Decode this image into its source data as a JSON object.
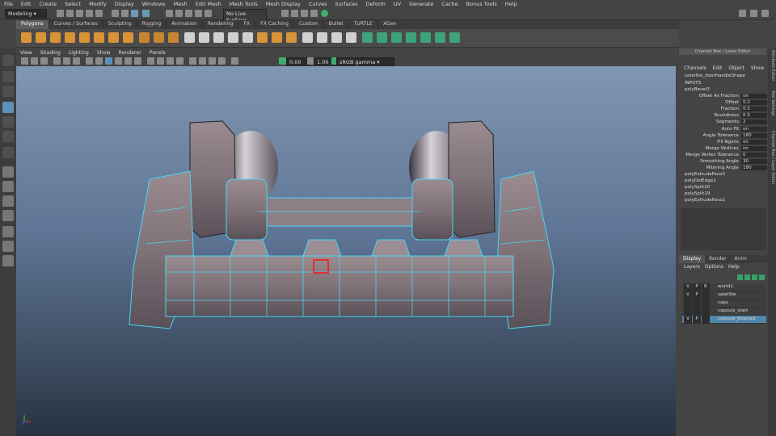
{
  "menubar": [
    "File",
    "Edit",
    "Create",
    "Select",
    "Modify",
    "Display",
    "Windows",
    "Mesh",
    "Edit Mesh",
    "Mesh Tools",
    "Mesh Display",
    "Curves",
    "Surfaces",
    "Deform",
    "UV",
    "Generate",
    "Cache",
    "Bonus Tools",
    "Help"
  ],
  "status": {
    "mode": "Modeling",
    "live_surface": "No Live Surface"
  },
  "shelf_tabs": [
    "Polygons",
    "Curves / Surfaces",
    "Sculpting",
    "Rigging",
    "Animation",
    "Rendering",
    "FX",
    "FX Caching",
    "Custom",
    "Bullet",
    "TURTLE",
    "XGen"
  ],
  "shelf_active": "Polygons",
  "panel_menu": [
    "View",
    "Shading",
    "Lighting",
    "Show",
    "Renderer",
    "Panels"
  ],
  "panel_tools": {
    "field1": "0.00",
    "field2": "1.00",
    "color_space": "sRGB gamma"
  },
  "channel_box": {
    "title": "Channel Box / Layer Editor",
    "menu": [
      "Channels",
      "Edit",
      "Object",
      "Show"
    ],
    "object": "satellite_doorHandleShape",
    "inputs_label": "INPUTS",
    "node": "polyBevel3",
    "attributes": [
      {
        "name": "Offset As Fraction",
        "value": "on"
      },
      {
        "name": "Offset",
        "value": "0.2"
      },
      {
        "name": "Fraction",
        "value": "0.5"
      },
      {
        "name": "Roundness",
        "value": "0.5"
      },
      {
        "name": "Segments",
        "value": "2"
      },
      {
        "name": "Auto Fit",
        "value": "on"
      },
      {
        "name": "Angle Tolerance",
        "value": "180"
      },
      {
        "name": "Fill Ngons",
        "value": "on"
      },
      {
        "name": "Merge Vertices",
        "value": "on"
      },
      {
        "name": "Merge Vertex Tolerance",
        "value": "0"
      },
      {
        "name": "Smoothing Angle",
        "value": "30"
      },
      {
        "name": "Mitering Angle",
        "value": "180"
      }
    ],
    "history": [
      "polyExtrudeFace3",
      "polyDelEdge1",
      "polySplit20",
      "polySplit19",
      "polyExtrudeFace2"
    ]
  },
  "layer_editor": {
    "tabs": [
      "Display",
      "Render",
      "Anim"
    ],
    "active_tab": "Display",
    "menu": [
      "Layers",
      "Options",
      "Help"
    ],
    "layers": [
      {
        "v": "V",
        "p": "P",
        "r": "R",
        "name": "world1",
        "selected": false
      },
      {
        "v": "V",
        "p": "P",
        "r": "",
        "name": "satellite",
        "selected": false
      },
      {
        "v": "",
        "p": "",
        "r": "",
        "name": "caps",
        "selected": false
      },
      {
        "v": "",
        "p": "",
        "r": "",
        "name": "capsule_start",
        "selected": false
      },
      {
        "v": "V",
        "p": "P",
        "r": "",
        "name": "capsule_finished",
        "selected": true
      }
    ]
  },
  "side_tabs": [
    "Attribute Editor",
    "Tool Settings",
    "Channel Box / Layer Editor"
  ],
  "colors": {
    "accent": "#5386ab",
    "wire": "#49d7f2",
    "selected_face": "#e03030"
  }
}
